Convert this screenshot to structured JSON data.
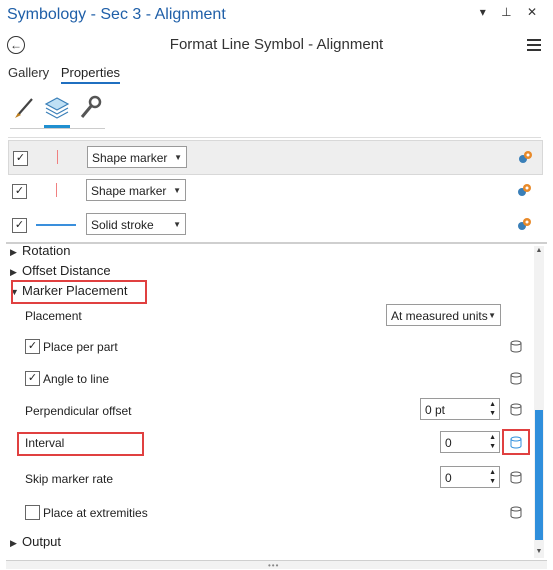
{
  "window": {
    "title": "Symbology - Sec 3 - Alignment",
    "ctrl_dropdown": "▾",
    "ctrl_pin": "⊥",
    "ctrl_close": "✕"
  },
  "header": {
    "back_icon": "back-arrow-icon",
    "title": "Format Line Symbol - Alignment",
    "menu_icon": "hamburger-icon"
  },
  "tabs": [
    "Gallery",
    "Properties"
  ],
  "subtabs": [
    "paintbrush-icon",
    "layers-icon",
    "wrench-icon"
  ],
  "layers": [
    {
      "checked": true,
      "preview": "marker-line-red",
      "type": "Shape marker"
    },
    {
      "checked": true,
      "preview": "marker-line-red",
      "type": "Shape marker"
    },
    {
      "checked": true,
      "preview": "solid-line-blue",
      "type": "Solid stroke"
    }
  ],
  "sections": {
    "rotation": "Rotation",
    "offset_distance": "Offset Distance",
    "marker_placement": "Marker Placement",
    "output": "Output"
  },
  "placement": {
    "label": "Placement",
    "value": "At measured units",
    "place_per_part": {
      "label": "Place per part",
      "checked": true
    },
    "angle_to_line": {
      "label": "Angle to line",
      "checked": true
    },
    "perpendicular_offset": {
      "label": "Perpendicular offset",
      "value": "0 pt"
    },
    "interval": {
      "label": "Interval",
      "value": "0"
    },
    "skip_marker_rate": {
      "label": "Skip marker rate",
      "value": "0"
    },
    "place_at_extremities": {
      "label": "Place at extremities",
      "checked": false
    }
  },
  "colors": {
    "accent": "#1f6fc0",
    "title": "#1f5fa8",
    "highlight": "#e04040",
    "scroll": "#2f8fdc"
  }
}
